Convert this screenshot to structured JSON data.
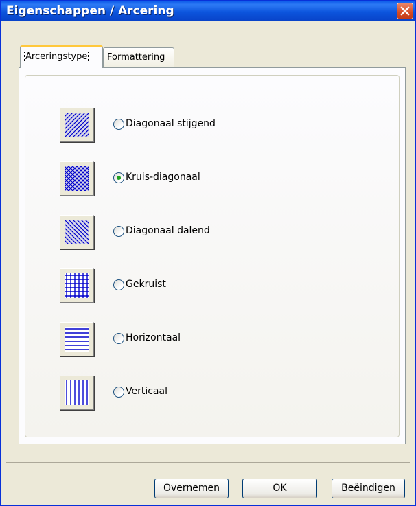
{
  "window": {
    "title": "Eigenschappen / Arcering"
  },
  "tabs": [
    {
      "label": "Arceringstype",
      "active": true
    },
    {
      "label": "Formattering",
      "active": false
    }
  ],
  "hatch_options": [
    {
      "label": "Diagonaal stijgend",
      "pattern": "diagonal-rising",
      "selected": false
    },
    {
      "label": "Kruis-diagonaal",
      "pattern": "cross-diagonal",
      "selected": true
    },
    {
      "label": "Diagonaal dalend",
      "pattern": "diagonal-falling",
      "selected": false
    },
    {
      "label": "Gekruist",
      "pattern": "grid",
      "selected": false
    },
    {
      "label": "Horizontaal",
      "pattern": "horizontal",
      "selected": false
    },
    {
      "label": "Verticaal",
      "pattern": "vertical",
      "selected": false
    }
  ],
  "buttons": {
    "apply": "Overnemen",
    "ok": "OK",
    "close": "Beëindigen"
  },
  "colors": {
    "hatch": "#0000CC",
    "titlebar": "#0A58E8",
    "radio_dot": "#21A121",
    "close": "#D54B24"
  }
}
